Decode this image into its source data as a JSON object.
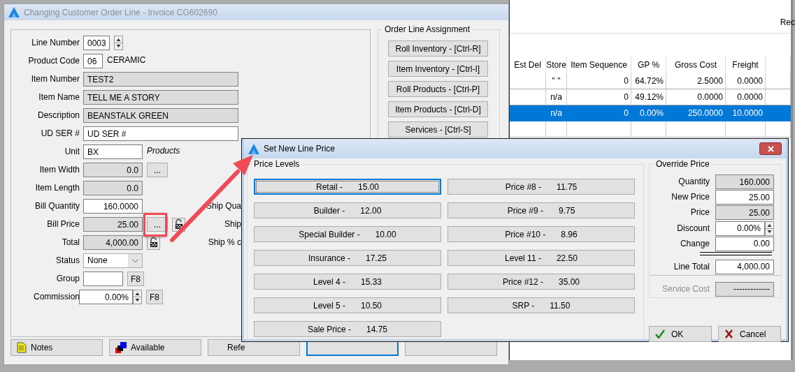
{
  "background_window": {
    "corner_text": "Rec",
    "table": {
      "columns": [
        "Est Del",
        "Store",
        "Item Sequence",
        "GP %",
        "Gross Cost",
        "Freight"
      ],
      "rows": [
        {
          "cells": [
            null,
            "\" \"",
            "0",
            "64.72%",
            "2.5000",
            "0.0000"
          ],
          "selected": false
        },
        {
          "cells": [
            null,
            "n/a",
            "0",
            "49.12%",
            "0.0000",
            "0.0000"
          ],
          "selected": false
        },
        {
          "cells": [
            null,
            "n/a",
            "0",
            "0.00%",
            "250.0000",
            "10.0000"
          ],
          "selected": true
        }
      ]
    }
  },
  "main_window": {
    "title": "Changing Customer Order Line - Invoice CG602690",
    "fields": [
      {
        "label": "Line Number",
        "kind": "spin",
        "value": "0003"
      },
      {
        "label": "Product Code",
        "kind": "code",
        "value": "06",
        "note": "CERAMIC"
      },
      {
        "label": "Item Number",
        "kind": "readonly",
        "value": "TEST2"
      },
      {
        "label": "Item Name",
        "kind": "readonly",
        "value": "TELL ME A STORY"
      },
      {
        "label": "Description",
        "kind": "readonly",
        "value": "BEANSTALK GREEN"
      },
      {
        "label": "UD SER #",
        "kind": "text",
        "value": "UD SER #"
      },
      {
        "label": "Unit",
        "kind": "unit",
        "value": "BX",
        "note": "Products"
      },
      {
        "label": "Item Width",
        "kind": "readonly_short",
        "value": "0.0",
        "button": "..."
      },
      {
        "label": "Item Length",
        "kind": "readonly_short",
        "value": "0.0"
      },
      {
        "label": "Bill Quantity",
        "kind": "number",
        "value": "160.0000",
        "side_label": "Ship Qua"
      },
      {
        "label": "Bill Price",
        "kind": "readonly_short",
        "value": "25.00",
        "button": "...",
        "locked": true,
        "highlighted": true,
        "side_label": "Ship"
      },
      {
        "label": "Total",
        "kind": "readonly_short",
        "value": "4,000.00",
        "locked": true,
        "side_label": "Ship % c"
      },
      {
        "label": "Status",
        "kind": "dropdown",
        "value": "None"
      },
      {
        "label": "Group",
        "kind": "short",
        "button": "F8"
      },
      {
        "label": "Commission",
        "kind": "percent_spin",
        "value": "0.00%",
        "button": "F8"
      }
    ],
    "assignment": {
      "title": "Order Line Assignment",
      "buttons": [
        "Roll Inventory - [Ctrl-R]",
        "Item Inventory - [Ctrl-I]",
        "Roll Products - [Ctrl-P]",
        "Item Products - [Ctrl-D]",
        "Services - [Ctrl-S]"
      ]
    },
    "bottom_buttons": [
      {
        "kind": "notes",
        "label": "Notes",
        "focused": false
      },
      {
        "kind": "available",
        "label": "Available",
        "focused": false
      },
      {
        "kind": "cut",
        "label": "Refe",
        "focused": false
      },
      {
        "kind": "blank",
        "focused": true
      },
      {
        "kind": "blank",
        "focused": false
      }
    ]
  },
  "price_dialog": {
    "title": "Set New Line Price",
    "levels_title": "Price Levels",
    "levels": [
      {
        "name": "Retail -",
        "price": "15.00",
        "focused": true
      },
      {
        "name": "Builder -",
        "price": "12.00",
        "focused": false
      },
      {
        "name": "Special Builder -",
        "price": "10.00",
        "focused": false
      },
      {
        "name": "Insurance -",
        "price": "17.25",
        "focused": false
      },
      {
        "name": "Level 4 -",
        "price": "15.33",
        "focused": false
      },
      {
        "name": "Level 5 -",
        "price": "10.50",
        "focused": false
      },
      {
        "name": "Sale Price -",
        "price": "14.75",
        "focused": false
      },
      {
        "name": "Price #8 -",
        "price": "11.75",
        "focused": false
      },
      {
        "name": "Price #9 -",
        "price": "9.75",
        "focused": false
      },
      {
        "name": "Price #10 -",
        "price": "8.96",
        "focused": false
      },
      {
        "name": "Level 11 -",
        "price": "22.50",
        "focused": false
      },
      {
        "name": "Price #12 -",
        "price": "35.00",
        "focused": false
      },
      {
        "name": "SRP -",
        "price": "11.50",
        "focused": false
      }
    ],
    "override": {
      "title": "Override Price",
      "fields": [
        {
          "label": "Quantity",
          "value": "160.000",
          "kind": "readonly"
        },
        {
          "label": "New Price",
          "value": "25.00",
          "kind": "input"
        },
        {
          "label": "Price",
          "value": "25.00",
          "kind": "readonly"
        },
        {
          "label": "Discount",
          "value": "0.00%",
          "kind": "spin"
        },
        {
          "label": "Change",
          "value": "0.00",
          "kind": "input"
        },
        {
          "label": "Line Total",
          "value": "4,000.00",
          "kind": "total"
        }
      ],
      "service_cost": {
        "label": "Service Cost",
        "value": "-------------",
        "disabled": true
      }
    },
    "buttons": [
      {
        "kind": "ok",
        "label": "OK"
      },
      {
        "kind": "cancel",
        "label": "Cancel"
      }
    ]
  }
}
